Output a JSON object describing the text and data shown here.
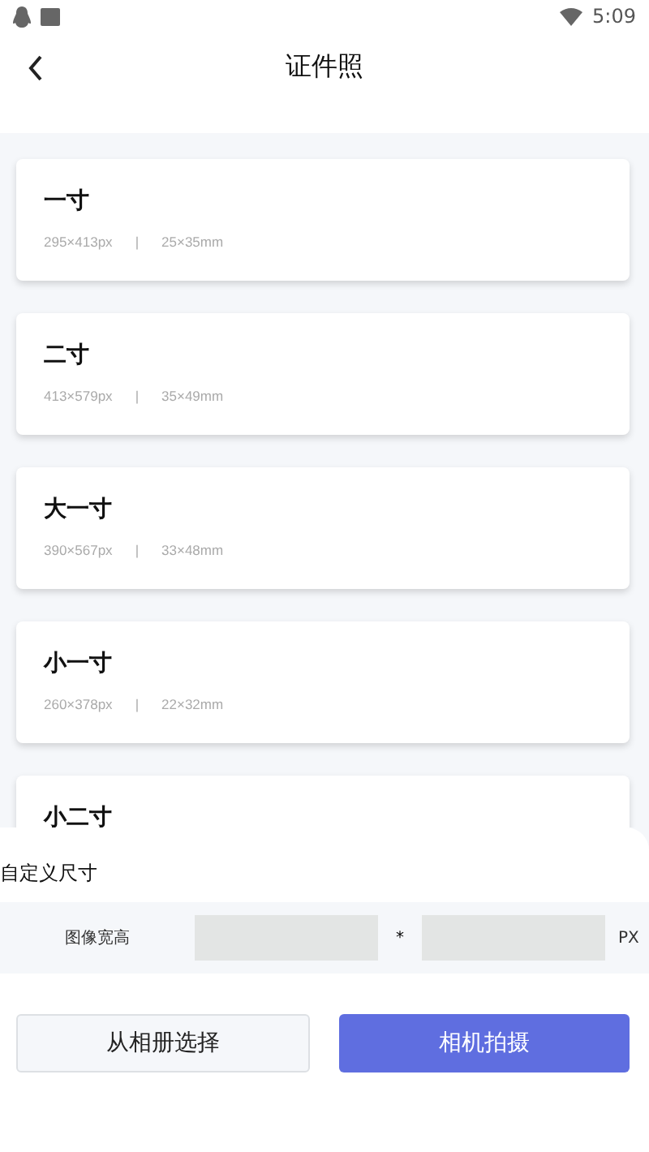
{
  "status_bar": {
    "time": "5:09"
  },
  "header": {
    "title": "证件照"
  },
  "sizes": [
    {
      "name": "一寸",
      "pixels": "295×413px",
      "separator": "|",
      "millimeters": "25×35mm"
    },
    {
      "name": "二寸",
      "pixels": "413×579px",
      "separator": "|",
      "millimeters": "35×49mm"
    },
    {
      "name": "大一寸",
      "pixels": "390×567px",
      "separator": "|",
      "millimeters": "33×48mm"
    },
    {
      "name": "小一寸",
      "pixels": "260×378px",
      "separator": "|",
      "millimeters": "22×32mm"
    },
    {
      "name": "小二寸"
    }
  ],
  "custom_size": {
    "title": "自定义尺寸",
    "label": "图像宽高",
    "times": "*",
    "unit": "PX"
  },
  "buttons": [
    {
      "label": "从相册选择",
      "kind": "secondary"
    },
    {
      "label": "相机拍摄",
      "kind": "primary"
    }
  ]
}
